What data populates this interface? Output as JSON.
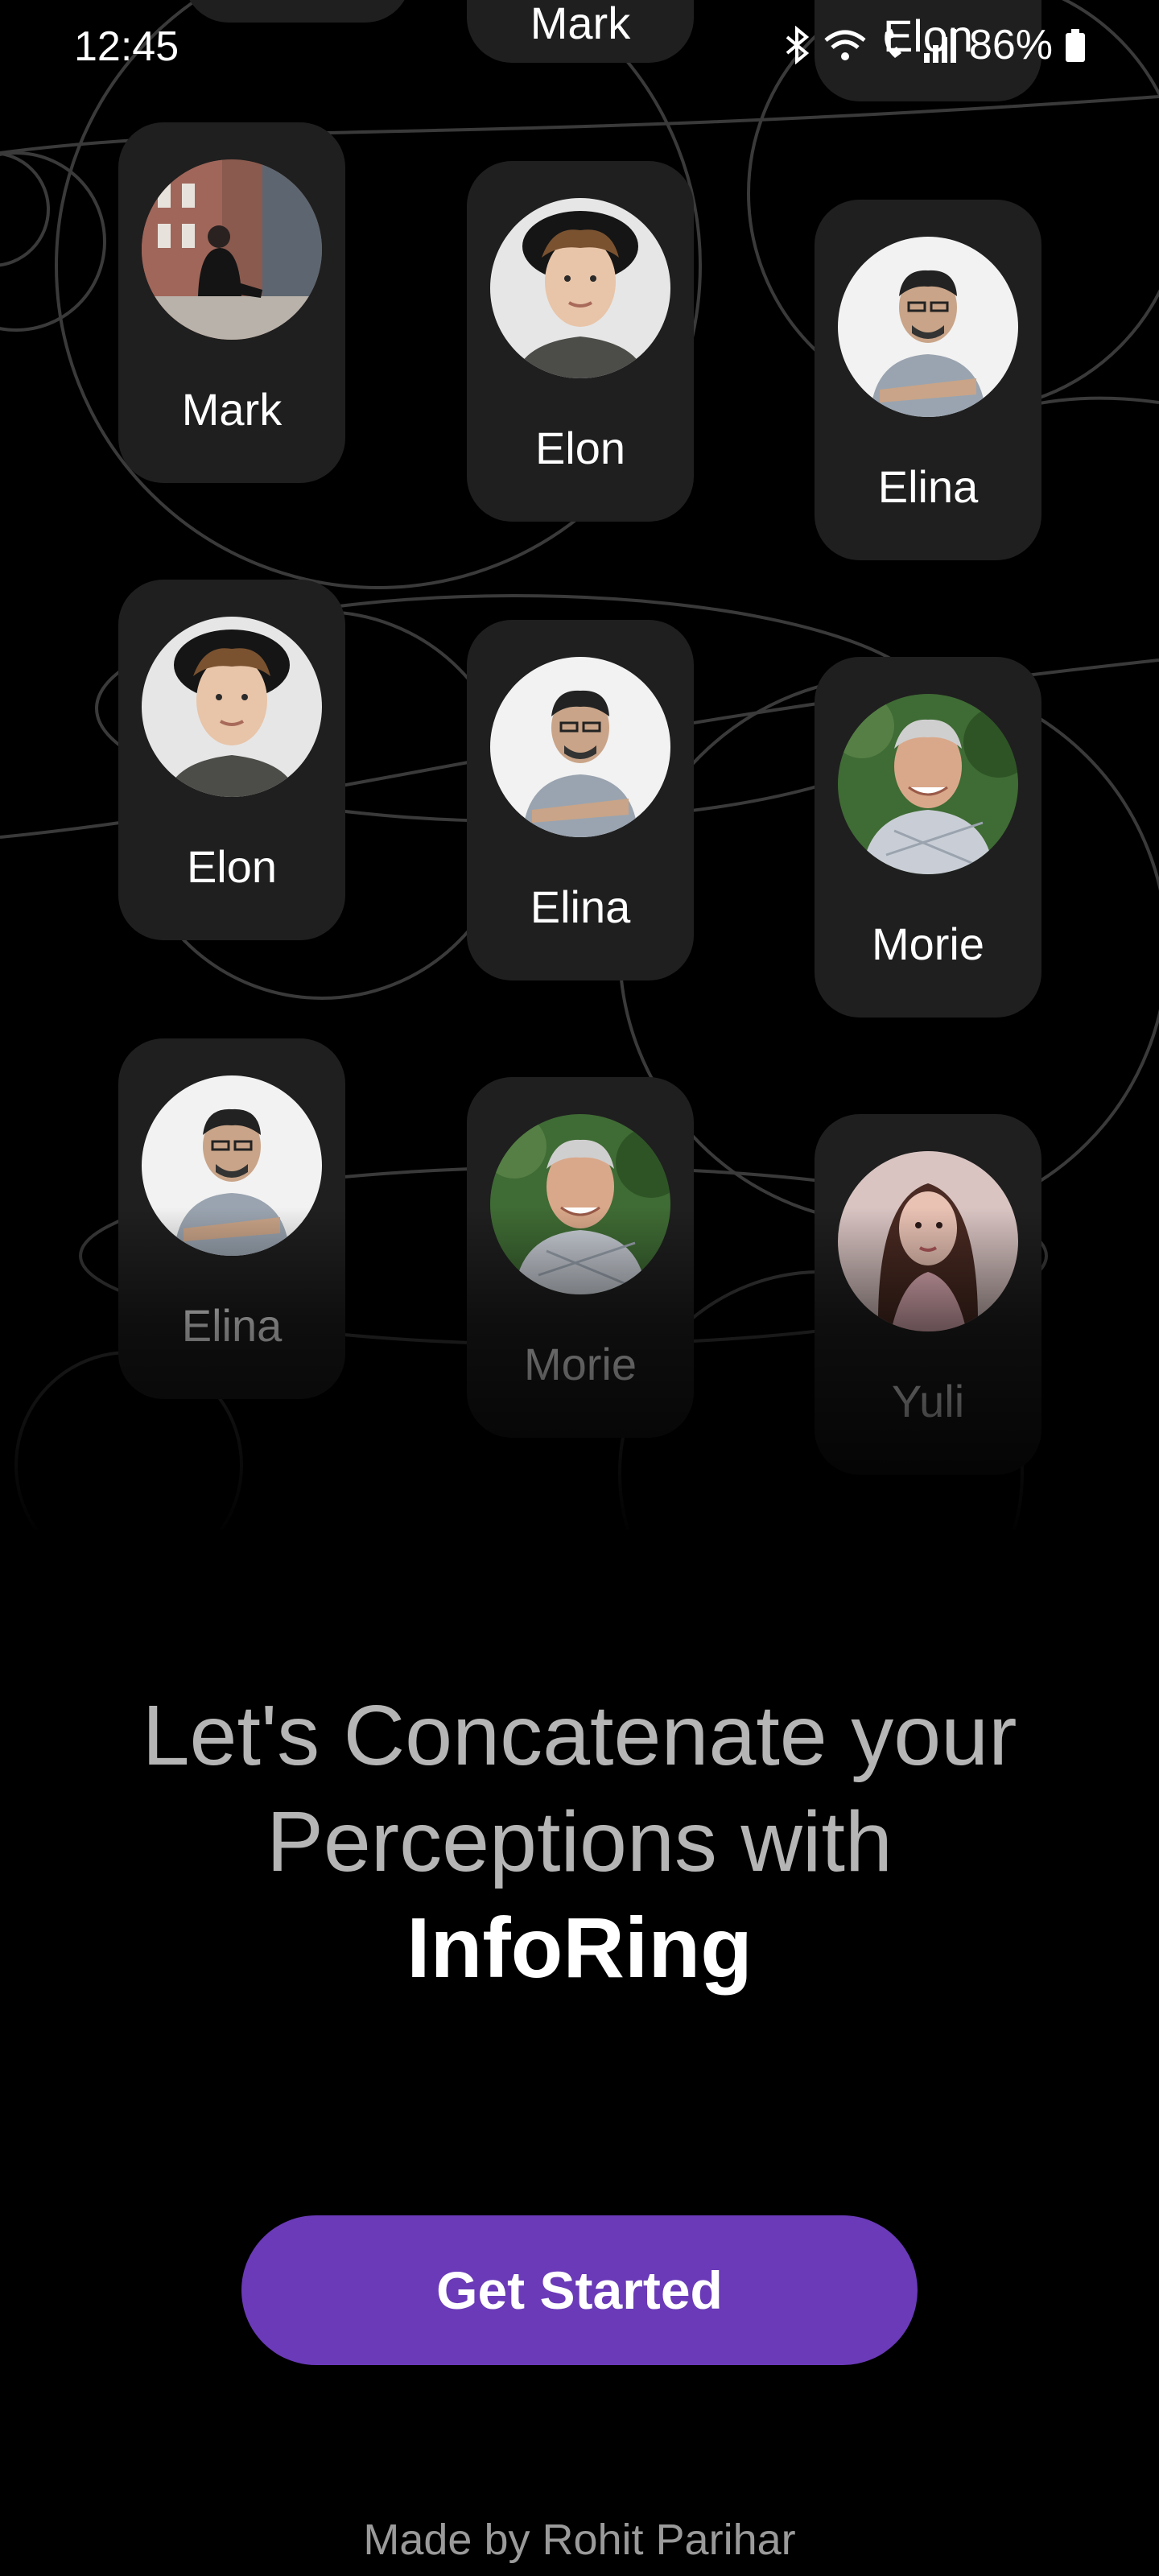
{
  "status_bar": {
    "time": "12:45",
    "battery": "86%"
  },
  "cards": [
    {
      "name": "Mark",
      "avatar": "man-sitting-on-ledge-photo"
    },
    {
      "name": "Elon",
      "avatar": "curly-hair-man-hat-photo"
    },
    {
      "name": "Elina",
      "avatar": "man-glasses-arms-crossed-photo"
    },
    {
      "name": "Elon",
      "avatar": "curly-hair-man-hat-photo"
    },
    {
      "name": "Elina",
      "avatar": "man-glasses-arms-crossed-photo"
    },
    {
      "name": "Morie",
      "avatar": "older-man-plaid-shirt-photo"
    },
    {
      "name": "Elina",
      "avatar": "man-glasses-arms-crossed-photo"
    },
    {
      "name": "Morie",
      "avatar": "older-man-plaid-shirt-photo"
    },
    {
      "name": "Yuli",
      "avatar": "woman-long-hair-photo"
    }
  ],
  "top_partial_cards": [
    "Mark",
    "Elon"
  ],
  "headline": {
    "line1": "Let's Concatenate your",
    "line2": "Perceptions with",
    "brand": "InfoRing"
  },
  "cta": {
    "label": "Get Started"
  },
  "footer": {
    "credit": "Made by Rohit Parihar"
  },
  "colors": {
    "background": "#000000",
    "card": "#1f1f1f",
    "accent": "#6a3ab8"
  }
}
